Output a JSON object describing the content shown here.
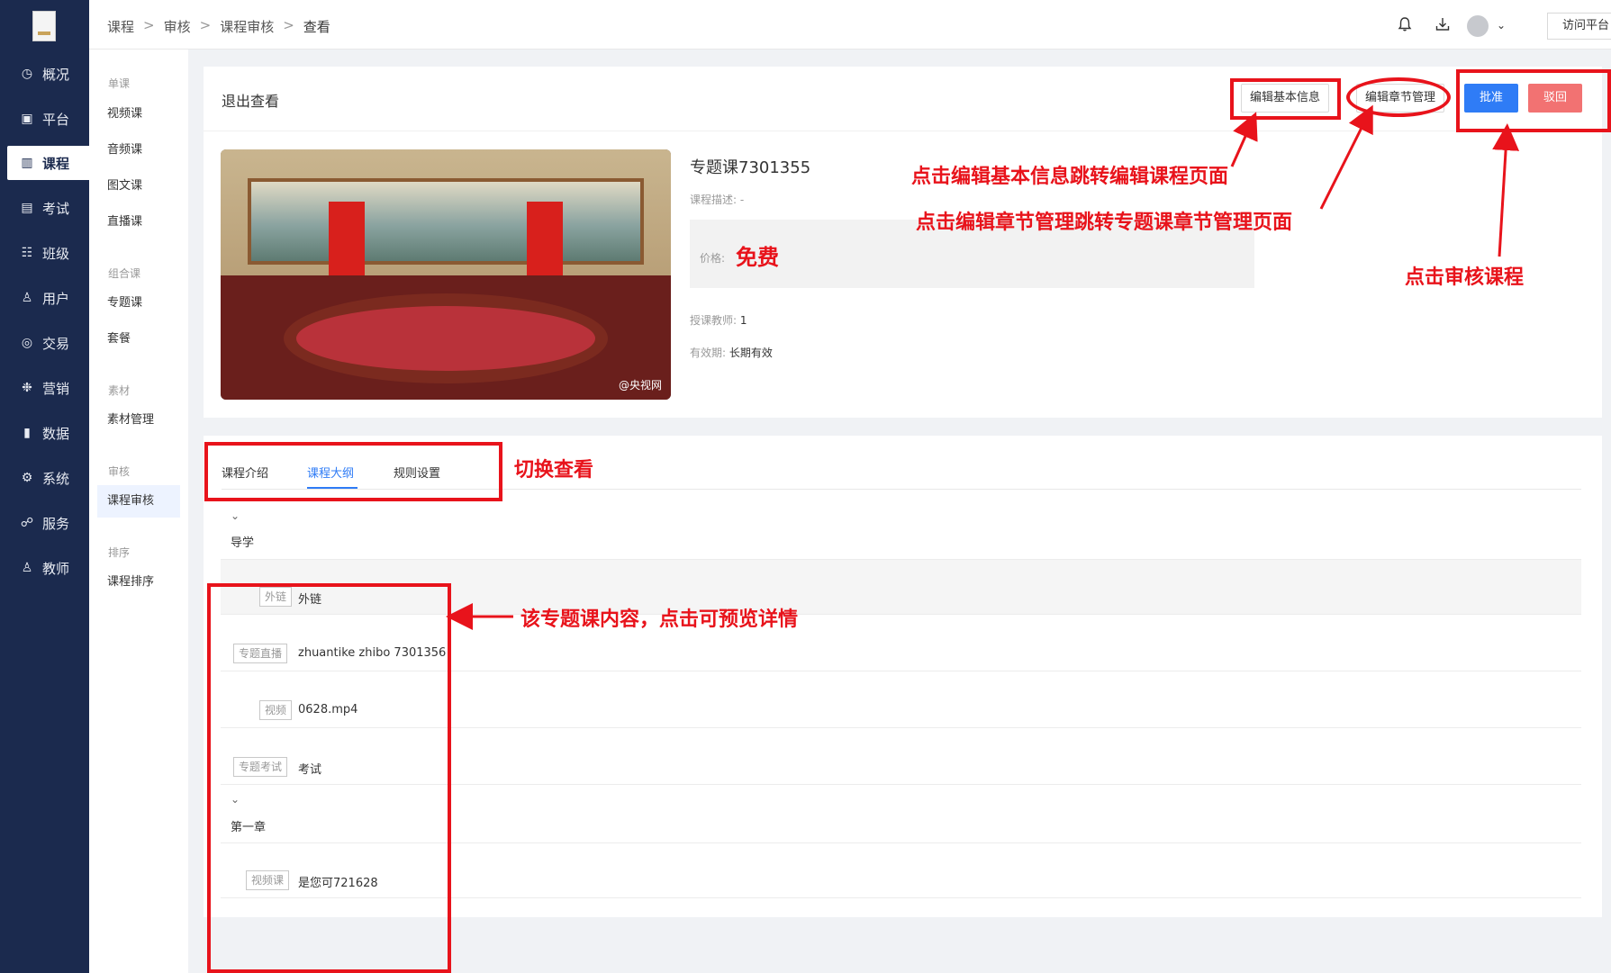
{
  "sidebar": {
    "items": [
      {
        "label": "概况",
        "icon": "clock-icon",
        "glyph": "◷"
      },
      {
        "label": "平台",
        "icon": "platform-icon",
        "glyph": "▣"
      },
      {
        "label": "课程",
        "icon": "book-icon",
        "glyph": "▥"
      },
      {
        "label": "考试",
        "icon": "exam-icon",
        "glyph": "▤"
      },
      {
        "label": "班级",
        "icon": "class-icon",
        "glyph": "☷"
      },
      {
        "label": "用户",
        "icon": "user-icon",
        "glyph": "♙"
      },
      {
        "label": "交易",
        "icon": "trade-icon",
        "glyph": "◎"
      },
      {
        "label": "营销",
        "icon": "marketing-icon",
        "glyph": "❉"
      },
      {
        "label": "数据",
        "icon": "chart-icon",
        "glyph": "▮"
      },
      {
        "label": "系统",
        "icon": "gear-icon",
        "glyph": "⚙"
      },
      {
        "label": "服务",
        "icon": "service-icon",
        "glyph": "☍"
      },
      {
        "label": "教师",
        "icon": "teacher-icon",
        "glyph": "♙"
      }
    ]
  },
  "subnav": {
    "groups": [
      "单课",
      "组合课",
      "素材",
      "审核",
      "排序"
    ],
    "items": [
      "视频课",
      "音频课",
      "图文课",
      "直播课",
      "专题课",
      "套餐",
      "素材管理",
      "课程审核",
      "课程排序"
    ]
  },
  "breadcrumb": [
    "课程",
    "审核",
    "课程审核",
    "查看"
  ],
  "topbar": {
    "visit_label": "访问平台"
  },
  "header": {
    "exit_label": "退出查看",
    "edit_basic_label": "编辑基本信息",
    "edit_chapter_label": "编辑章节管理",
    "approve_label": "批准",
    "reject_label": "驳回"
  },
  "course": {
    "title": "专题课7301355",
    "desc_label": "课程描述:",
    "desc_value": "-",
    "price_label": "价格:",
    "price_value": "免费",
    "teacher_label": "授课教师:",
    "teacher_value": "1",
    "valid_label": "有效期:",
    "valid_value": "长期有效",
    "cover_watermark": "@央视网"
  },
  "tabs": [
    "课程介绍",
    "课程大纲",
    "规则设置"
  ],
  "outline": {
    "chevron": "⌄",
    "chapters": [
      {
        "label": "导学",
        "items": [
          {
            "tag": "外链",
            "name": "外链"
          },
          {
            "tag": "专题直播",
            "name": "zhuantike zhibo 7301356"
          },
          {
            "tag": "视频",
            "name": "0628.mp4"
          },
          {
            "tag": "专题考试",
            "name": "考试"
          }
        ]
      },
      {
        "label": "第一章",
        "items": [
          {
            "tag": "视频课",
            "name": "是您可721628"
          }
        ]
      }
    ]
  },
  "annotations": {
    "edit_basic": "点击编辑基本信息跳转编辑课程页面",
    "edit_chapter": "点击编辑章节管理跳转专题课章节管理页面",
    "review": "点击审核课程",
    "switch": "切换查看",
    "content": "该专题课内容，点击可预览详情",
    "color": "#e8131b"
  }
}
